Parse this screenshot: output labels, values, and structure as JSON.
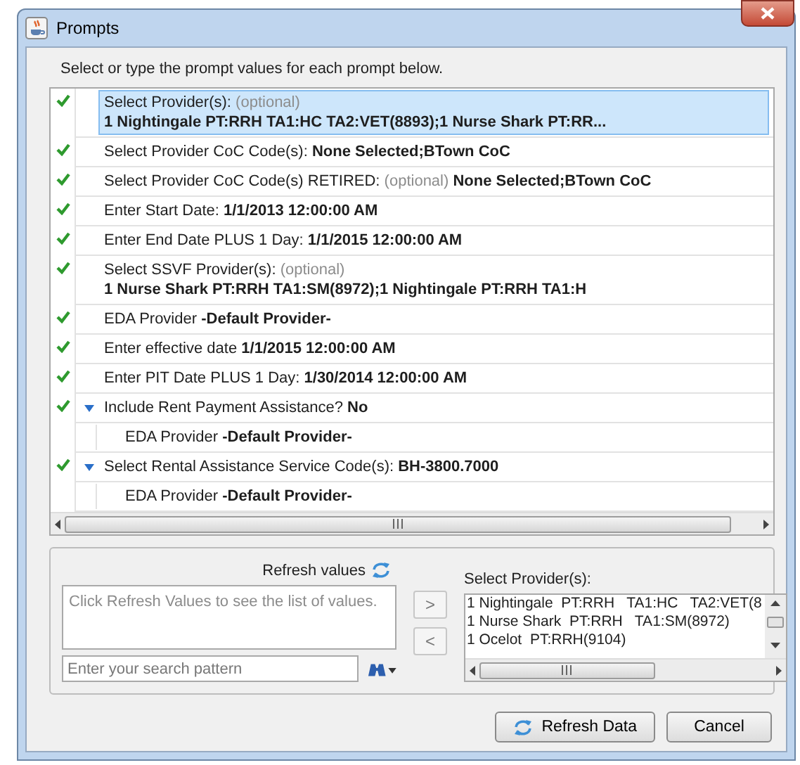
{
  "window": {
    "title": "Prompts"
  },
  "instruction": "Select or type the prompt values for each prompt below.",
  "prompts": [
    {
      "label": "Select Provider(s):",
      "hint": "(optional)",
      "value": "1 Nightingale PT:RRH TA1:HC TA2:VET(8893);1 Nurse Shark PT:RR...",
      "answered": true,
      "selected": true
    },
    {
      "label": "Select Provider CoC Code(s):",
      "value": "None Selected;BTown CoC",
      "answered": true,
      "selected": false
    },
    {
      "label": "Select Provider CoC Code(s) RETIRED:",
      "hint": "(optional)",
      "value": "None Selected;BTown CoC",
      "answered": true,
      "selected": false
    },
    {
      "label": "Enter Start Date:",
      "value": "1/1/2013 12:00:00 AM",
      "answered": true,
      "selected": false
    },
    {
      "label": "Enter End Date PLUS 1 Day:",
      "value": "1/1/2015 12:00:00 AM",
      "answered": true,
      "selected": false
    },
    {
      "label": "Select SSVF Provider(s):",
      "hint": "(optional)",
      "value": "1 Nurse Shark PT:RRH TA1:SM(8972);1 Nightingale PT:RRH TA1:H",
      "answered": true,
      "selected": false
    },
    {
      "label": "EDA Provider",
      "value": "-Default Provider-",
      "answered": true,
      "selected": false
    },
    {
      "label": "Enter effective date",
      "value": "1/1/2015 12:00:00 AM",
      "answered": true,
      "selected": false
    },
    {
      "label": "Enter PIT Date PLUS 1 Day:",
      "value": "1/30/2014 12:00:00 AM",
      "answered": true,
      "selected": false
    },
    {
      "label": "Include Rent Payment Assistance?",
      "value": "No",
      "answered": true,
      "selected": false,
      "expanded": true,
      "children": [
        {
          "label": "EDA Provider",
          "value": "-Default Provider-"
        }
      ]
    },
    {
      "label": "Select Rental Assistance Service Code(s):",
      "value": "BH-3800.7000",
      "answered": true,
      "selected": false,
      "expanded": true,
      "children": [
        {
          "label": "EDA Provider",
          "value": "-Default Provider-"
        }
      ]
    }
  ],
  "values_panel": {
    "refresh_label": "Refresh values",
    "empty_message": "Click Refresh Values to see the list of values.",
    "search": {
      "placeholder": "Enter your search pattern"
    },
    "add_button": ">",
    "remove_button": "<",
    "selected_label": "Select Provider(s):",
    "selected_values": [
      "1 Nightingale  PT:RRH   TA1:HC   TA2:VET(8",
      "1 Nurse Shark  PT:RRH   TA1:SM(8972)",
      "1 Ocelot  PT:RRH(9104)"
    ]
  },
  "buttons": [
    {
      "label": "Refresh Data",
      "kind": "refresh"
    },
    {
      "label": "Cancel",
      "kind": "plain"
    }
  ]
}
